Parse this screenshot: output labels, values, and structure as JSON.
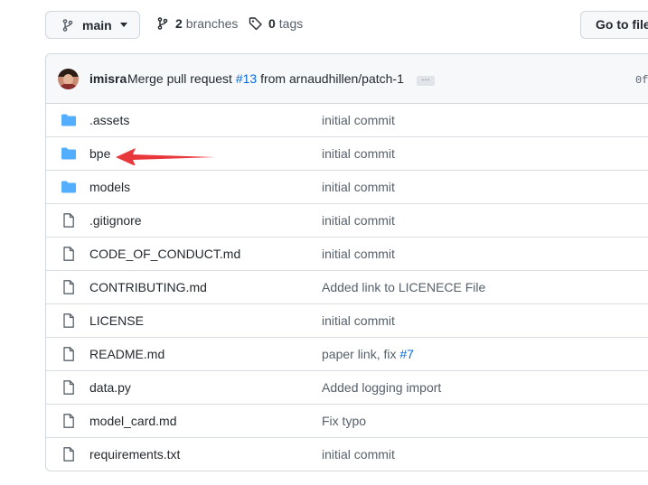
{
  "toolbar": {
    "branch_label": "main",
    "branches_count": "2",
    "branches_label": "branches",
    "tags_count": "0",
    "tags_label": "tags",
    "goto_file_label": "Go to file"
  },
  "commit": {
    "author": "imisra",
    "message_prefix": "Merge pull request",
    "pr_link": "#13",
    "message_suffix": "from arnaudhillen/patch-1",
    "ellipsis": "…",
    "sha": "0f"
  },
  "files": [
    {
      "type": "folder",
      "name": ".assets",
      "message": "initial commit"
    },
    {
      "type": "folder",
      "name": "bpe",
      "message": "initial commit"
    },
    {
      "type": "folder",
      "name": "models",
      "message": "initial commit"
    },
    {
      "type": "file",
      "name": ".gitignore",
      "message": "initial commit"
    },
    {
      "type": "file",
      "name": "CODE_OF_CONDUCT.md",
      "message": "initial commit"
    },
    {
      "type": "file",
      "name": "CONTRIBUTING.md",
      "message": "Added link to LICENECE File"
    },
    {
      "type": "file",
      "name": "LICENSE",
      "message": "initial commit"
    },
    {
      "type": "file",
      "name": "README.md",
      "message": "paper link, fix",
      "message_link": "#7"
    },
    {
      "type": "file",
      "name": "data.py",
      "message": "Added logging import"
    },
    {
      "type": "file",
      "name": "model_card.md",
      "message": "Fix typo"
    },
    {
      "type": "file",
      "name": "requirements.txt",
      "message": "initial commit"
    }
  ],
  "colors": {
    "folder": "#54aeff",
    "link": "#0969da",
    "arrow": "#e8383b"
  }
}
